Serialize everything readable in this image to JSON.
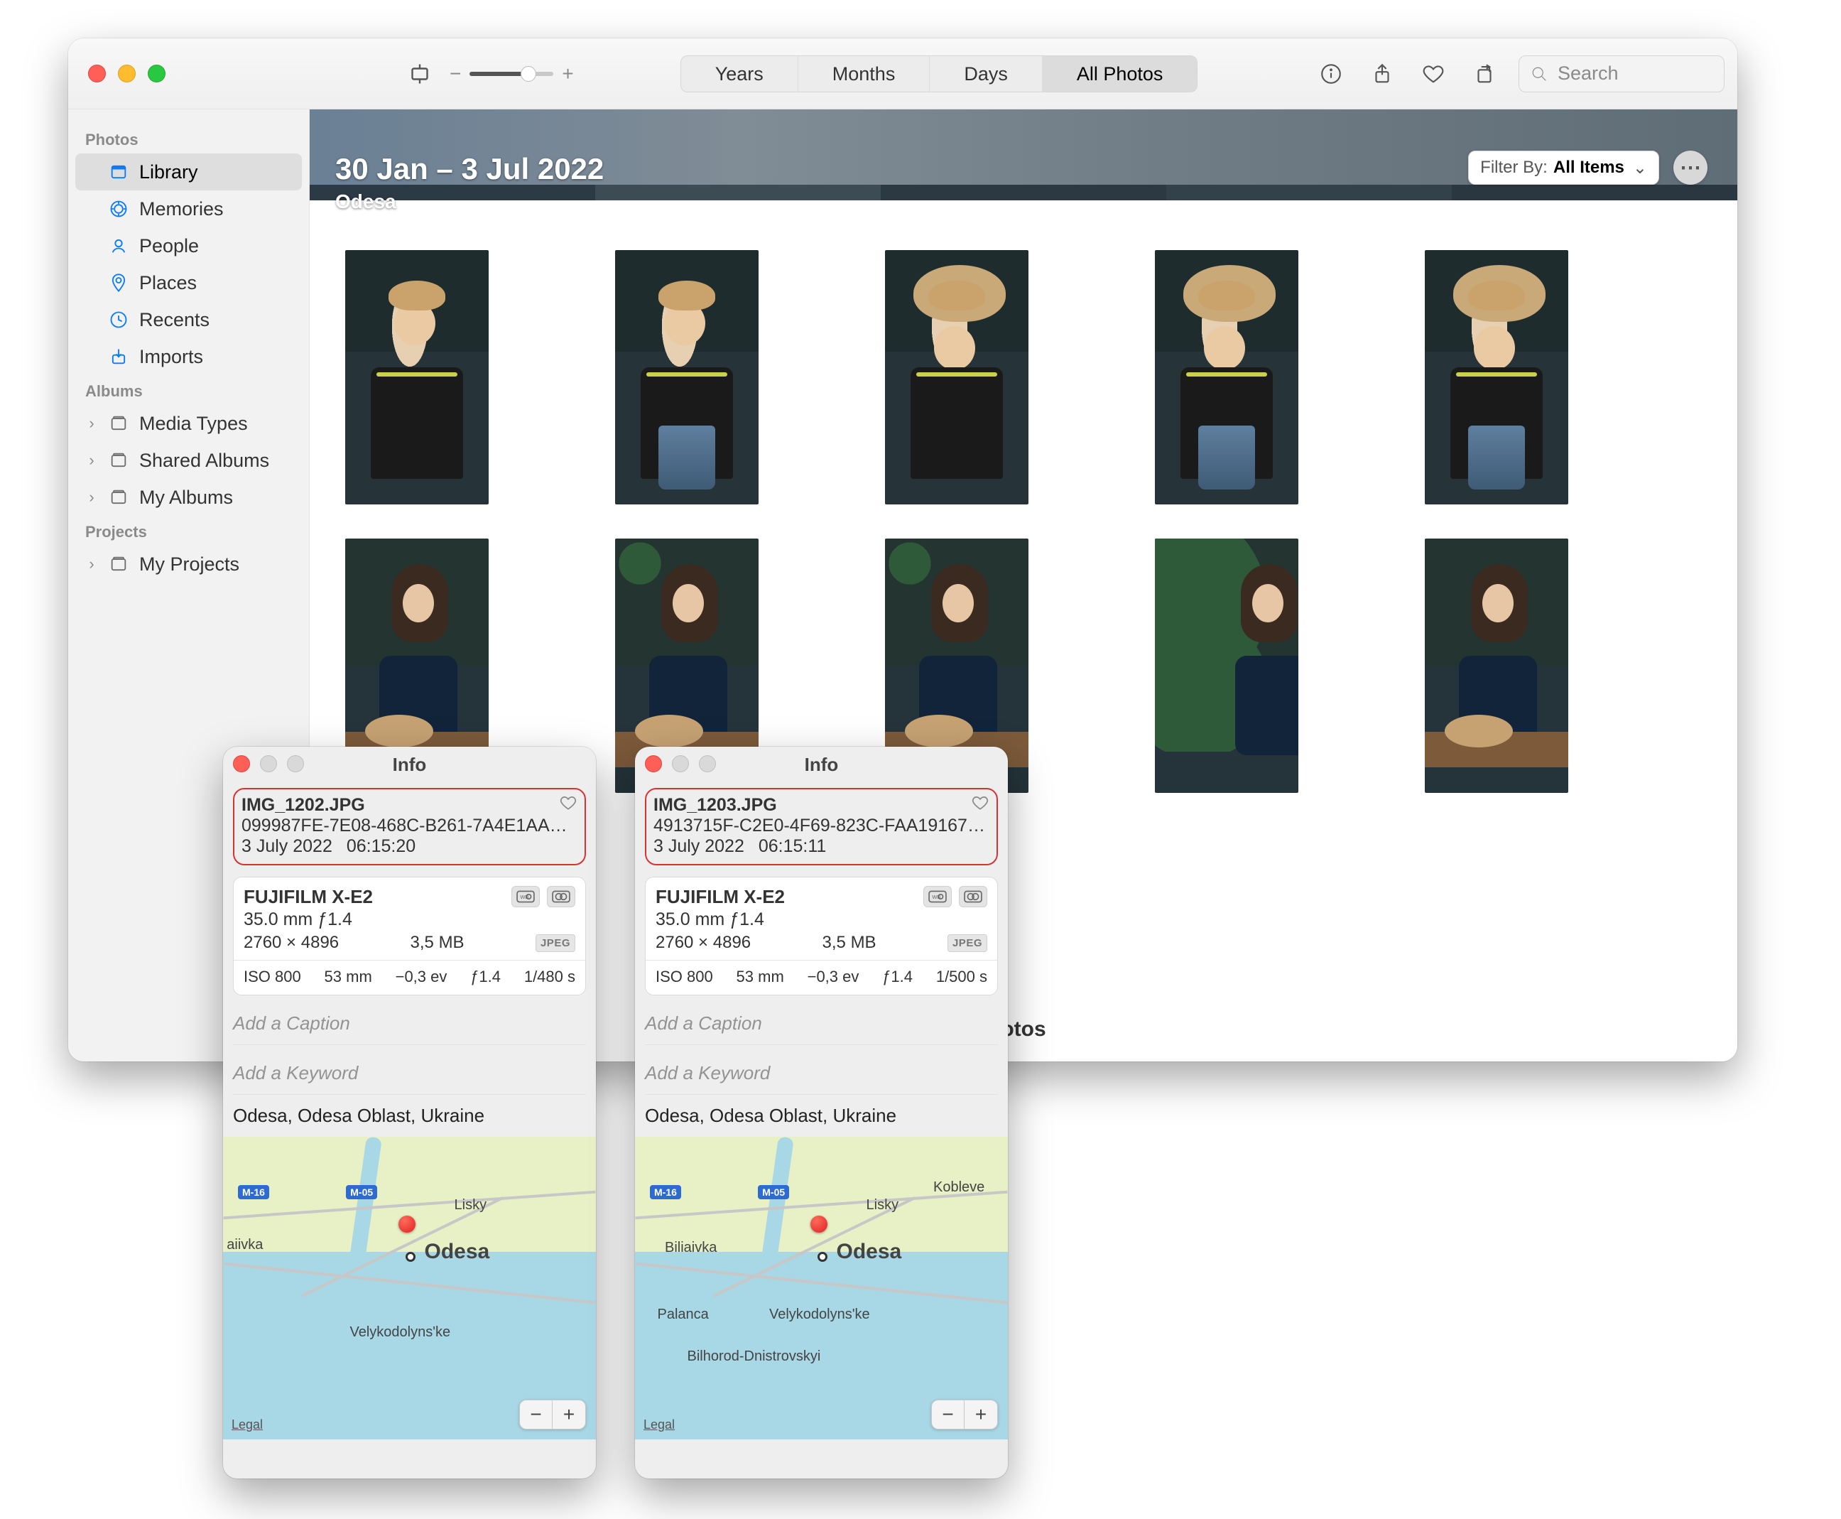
{
  "toolbar": {
    "view_segments": [
      "Years",
      "Months",
      "Days",
      "All Photos"
    ],
    "active_segment": "All Photos",
    "search_placeholder": "Search"
  },
  "sidebar": {
    "sections": [
      {
        "label": "Photos",
        "items": [
          {
            "label": "Library",
            "icon": "library",
            "selected": true
          },
          {
            "label": "Memories",
            "icon": "memories",
            "selected": false
          },
          {
            "label": "People",
            "icon": "people",
            "selected": false
          },
          {
            "label": "Places",
            "icon": "places",
            "selected": false
          },
          {
            "label": "Recents",
            "icon": "clock",
            "selected": false
          },
          {
            "label": "Imports",
            "icon": "import",
            "selected": false
          }
        ]
      },
      {
        "label": "Albums",
        "items": [
          {
            "label": "Media Types",
            "icon": "album",
            "disclosure": true
          },
          {
            "label": "Shared Albums",
            "icon": "album",
            "disclosure": true
          },
          {
            "label": "My Albums",
            "icon": "album",
            "disclosure": true
          }
        ]
      },
      {
        "label": "Projects",
        "items": [
          {
            "label": "My Projects",
            "icon": "album",
            "disclosure": true
          }
        ]
      }
    ]
  },
  "content": {
    "title": "30 Jan – 3 Jul 2022",
    "subtitle": "Odesa",
    "filter_prefix": "Filter By:",
    "filter_value": "All Items",
    "bottom_label_fragment": "otos"
  },
  "info_panels": [
    {
      "title": "Info",
      "filename": "IMG_1202.JPG",
      "uuid": "099987FE-7E08-468C-B261-7A4E1AAEFA…",
      "date": "3 July 2022",
      "time": "06:15:20",
      "camera": "FUJIFILM X-E2",
      "lens": "35.0 mm ƒ1.4",
      "dimensions": "2760 × 4896",
      "file_size": "3,5 MB",
      "file_type": "JPEG",
      "iso": "ISO 800",
      "focal": "53 mm",
      "ev": "−0,3 ev",
      "aperture": "ƒ1.4",
      "shutter": "1/480 s",
      "caption_placeholder": "Add a Caption",
      "keyword_placeholder": "Add a Keyword",
      "location_text": "Odesa, Odesa Oblast, Ukraine",
      "map": {
        "city": "Odesa",
        "places": [
          "Lisky",
          "aiivka",
          "Velykodolyns'ke"
        ],
        "shields": [
          "M-16",
          "M-05"
        ],
        "legal": "Legal"
      }
    },
    {
      "title": "Info",
      "filename": "IMG_1203.JPG",
      "uuid": "4913715F-C2E0-4F69-823C-FAA1916745B…",
      "date": "3 July 2022",
      "time": "06:15:11",
      "camera": "FUJIFILM X-E2",
      "lens": "35.0 mm ƒ1.4",
      "dimensions": "2760 × 4896",
      "file_size": "3,5 MB",
      "file_type": "JPEG",
      "iso": "ISO 800",
      "focal": "53 mm",
      "ev": "−0,3 ev",
      "aperture": "ƒ1.4",
      "shutter": "1/500 s",
      "caption_placeholder": "Add a Caption",
      "keyword_placeholder": "Add a Keyword",
      "location_text": "Odesa, Odesa Oblast, Ukraine",
      "map": {
        "city": "Odesa",
        "places": [
          "Lisky",
          "Biliaivka",
          "Velykodolyns'ke",
          "Palanca",
          "Kobleve",
          "Bilhorod-Dnistrovskyi"
        ],
        "shields": [
          "M-16",
          "M-05"
        ],
        "legal": "Legal"
      }
    }
  ]
}
